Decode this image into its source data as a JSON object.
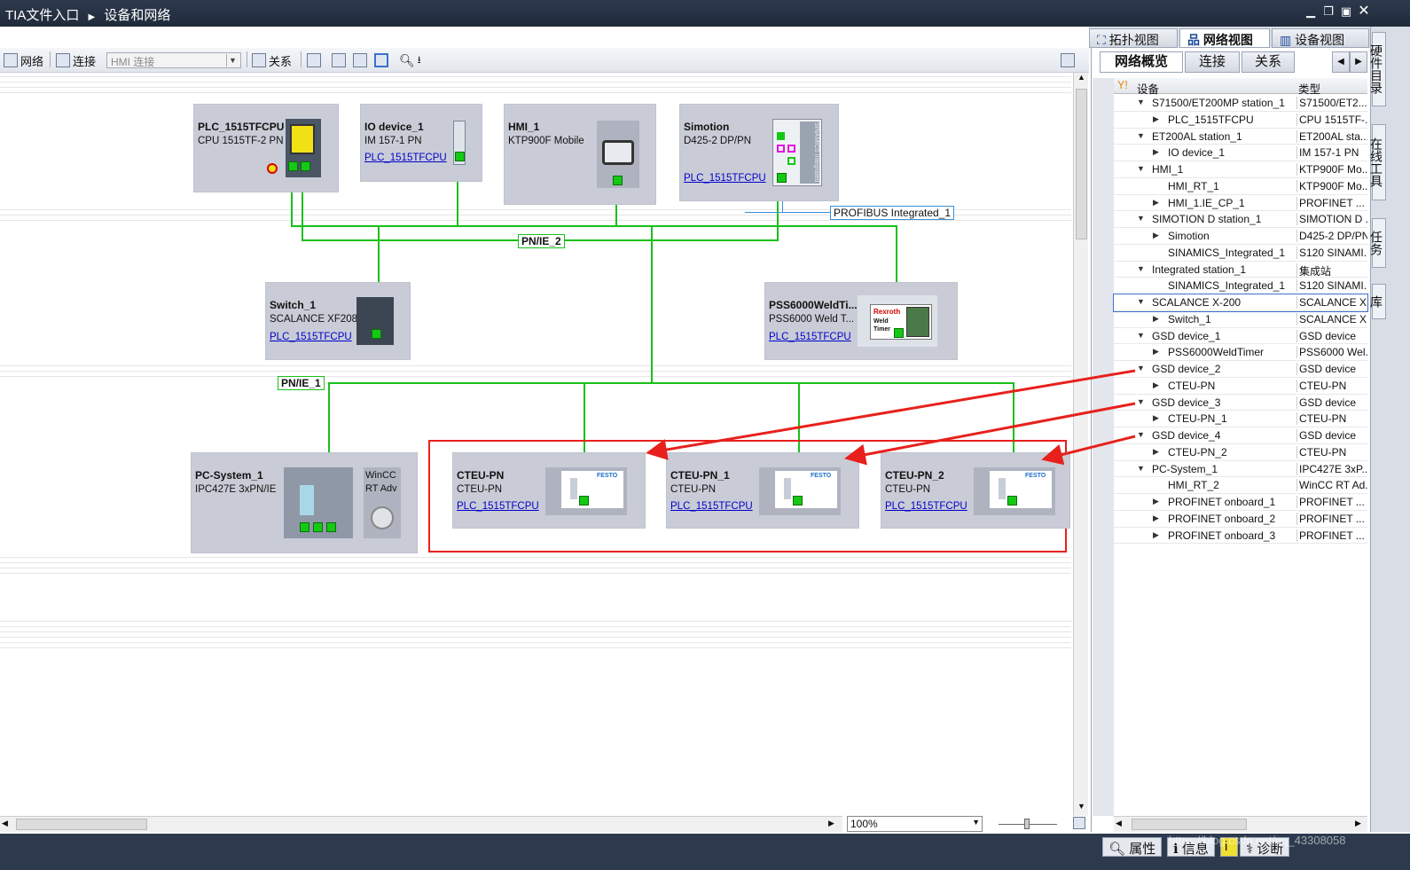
{
  "window": {
    "title": "TIA文件入口",
    "breadcrumb": "设备和网络"
  },
  "view_tabs": [
    "拓扑视图",
    "网络视图",
    "设备视图"
  ],
  "toolbar": {
    "network": "网络",
    "connection": "连接",
    "hmi_placeholder": "HMI 连接",
    "relation": "关系"
  },
  "devices": {
    "plc": {
      "name": "PLC_1515TFCPU",
      "type": "CPU 1515TF-2 PN"
    },
    "io": {
      "name": "IO device_1",
      "type": "IM 157-1 PN",
      "link": "PLC_1515TFCPU"
    },
    "hmi": {
      "name": "HMI_1",
      "type": "KTP900F Mobile"
    },
    "simotion": {
      "name": "Simotion",
      "type": "D425-2 DP/PN",
      "link": "PLC_1515TFCPU"
    },
    "switch": {
      "name": "Switch_1",
      "type": "SCALANCE XF208",
      "link": "PLC_1515TFCPU"
    },
    "pss": {
      "name": "PSS6000WeldTi...",
      "type": "PSS6000 Weld T...",
      "link": "PLC_1515TFCPU"
    },
    "pc": {
      "name": "PC-System_1",
      "type": "IPC427E 3xPN/IE",
      "wincc": "WinCC RT Adv"
    },
    "cteu1": {
      "name": "CTEU-PN",
      "type": "CTEU-PN",
      "link": "PLC_1515TFCPU"
    },
    "cteu2": {
      "name": "CTEU-PN_1",
      "type": "CTEU-PN",
      "link": "PLC_1515TFCPU"
    },
    "cteu3": {
      "name": "CTEU-PN_2",
      "type": "CTEU-PN",
      "link": "PLC_1515TFCPU"
    }
  },
  "device_labels": {
    "festo": "FESTO",
    "rexroth": "Rexroth",
    "weld_timer": "Weld Timer",
    "sinamics": "SINAMICS Integrated"
  },
  "networks": {
    "pnie2": "PN/IE_2",
    "pnie1": "PN/IE_1",
    "profibus": "PROFIBUS Integrated_1"
  },
  "zoom": "100%",
  "right_panel": {
    "tabs": [
      "网络概览",
      "连接",
      "关系"
    ],
    "col_device": "设备",
    "col_type": "类型",
    "rows": [
      {
        "name": "S71500/ET200MP station_1",
        "type": "S71500/ET2...",
        "level": 0,
        "tri": "▼"
      },
      {
        "name": "PLC_1515TFCPU",
        "type": "CPU 1515TF-...",
        "level": 1,
        "tri": "▶"
      },
      {
        "name": "ET200AL station_1",
        "type": "ET200AL sta...",
        "level": 0,
        "tri": "▼"
      },
      {
        "name": "IO device_1",
        "type": "IM 157-1 PN",
        "level": 1,
        "tri": "▶"
      },
      {
        "name": "HMI_1",
        "type": "KTP900F Mo...",
        "level": 0,
        "tri": "▼"
      },
      {
        "name": "HMI_RT_1",
        "type": "KTP900F Mo...",
        "level": 1,
        "tri": ""
      },
      {
        "name": "HMI_1.IE_CP_1",
        "type": "PROFINET ...",
        "level": 1,
        "tri": "▶"
      },
      {
        "name": "SIMOTION D station_1",
        "type": "SIMOTION D ...",
        "level": 0,
        "tri": "▼"
      },
      {
        "name": "Simotion",
        "type": "D425-2 DP/PN",
        "level": 1,
        "tri": "▶"
      },
      {
        "name": "SINAMICS_Integrated_1",
        "type": "S120 SINAMI...",
        "level": 1,
        "tri": ""
      },
      {
        "name": "Integrated station_1",
        "type": "集成站",
        "level": 0,
        "tri": "▼"
      },
      {
        "name": "SINAMICS_Integrated_1",
        "type": "S120 SINAMI...",
        "level": 1,
        "tri": ""
      },
      {
        "name": "SCALANCE X-200",
        "type": "SCALANCE X...",
        "level": 0,
        "tri": "▼"
      },
      {
        "name": "Switch_1",
        "type": "SCALANCE X...",
        "level": 1,
        "tri": "▶"
      },
      {
        "name": "GSD device_1",
        "type": "GSD device",
        "level": 0,
        "tri": "▼"
      },
      {
        "name": "PSS6000WeldTimer",
        "type": "PSS6000 Wel...",
        "level": 1,
        "tri": "▶"
      },
      {
        "name": "GSD device_2",
        "type": "GSD device",
        "level": 0,
        "tri": "▼"
      },
      {
        "name": "CTEU-PN",
        "type": "CTEU-PN",
        "level": 1,
        "tri": "▶"
      },
      {
        "name": "GSD device_3",
        "type": "GSD device",
        "level": 0,
        "tri": "▼"
      },
      {
        "name": "CTEU-PN_1",
        "type": "CTEU-PN",
        "level": 1,
        "tri": "▶"
      },
      {
        "name": "GSD device_4",
        "type": "GSD device",
        "level": 0,
        "tri": "▼"
      },
      {
        "name": "CTEU-PN_2",
        "type": "CTEU-PN",
        "level": 1,
        "tri": "▶"
      },
      {
        "name": "PC-System_1",
        "type": "IPC427E 3xP...",
        "level": 0,
        "tri": "▼"
      },
      {
        "name": "HMI_RT_2",
        "type": "WinCC RT Ad...",
        "level": 1,
        "tri": ""
      },
      {
        "name": "PROFINET onboard_1",
        "type": "PROFINET ...",
        "level": 1,
        "tri": "▶"
      },
      {
        "name": "PROFINET onboard_2",
        "type": "PROFINET ...",
        "level": 1,
        "tri": "▶"
      },
      {
        "name": "PROFINET onboard_3",
        "type": "PROFINET ...",
        "level": 1,
        "tri": "▶"
      }
    ],
    "selected_index": 12
  },
  "side_tabs": [
    "硬件目录",
    "在线工具",
    "任务",
    "库"
  ],
  "status": {
    "properties": "属性",
    "info": "信息",
    "diagnostics": "诊断",
    "watermark": "https://blog.csdn.net/qq_43308058"
  }
}
